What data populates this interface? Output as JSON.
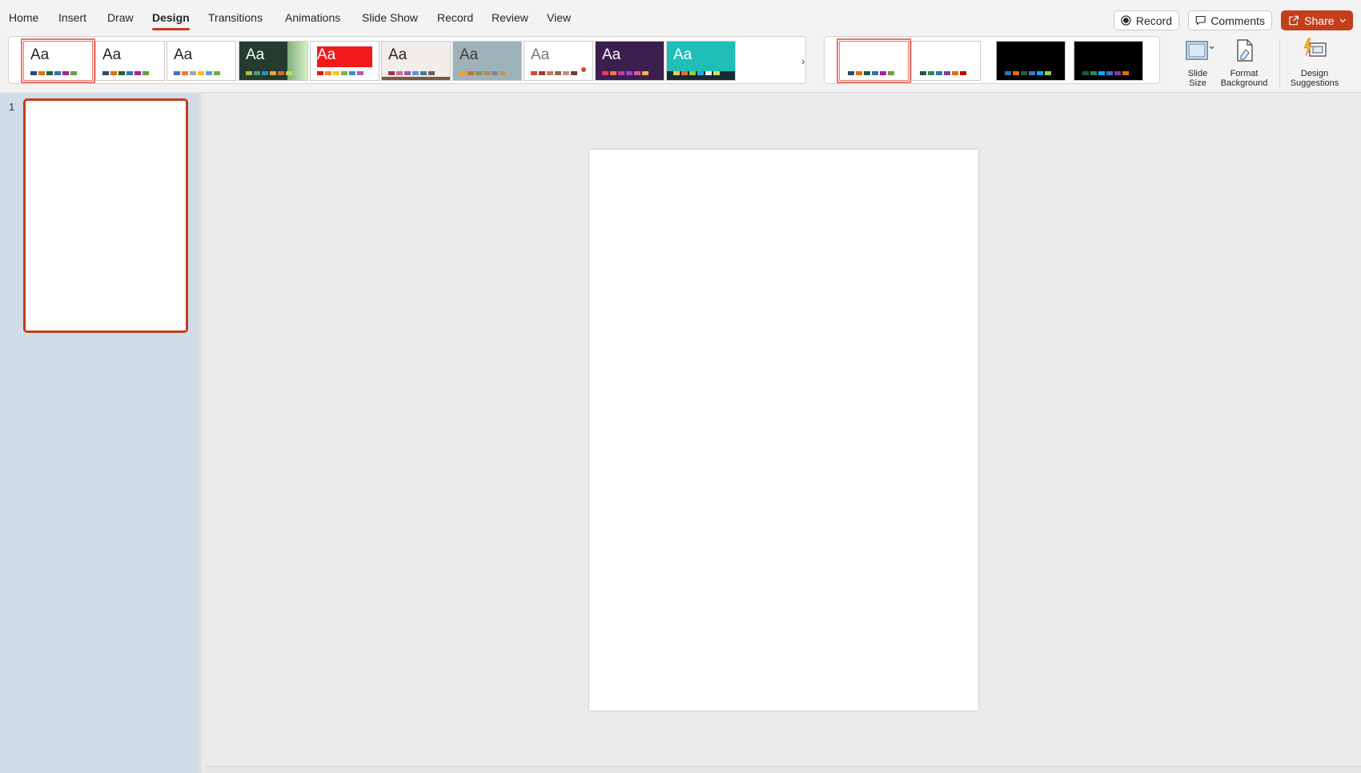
{
  "tabs": [
    {
      "label": "Home"
    },
    {
      "label": "Insert"
    },
    {
      "label": "Draw"
    },
    {
      "label": "Design"
    },
    {
      "label": "Transitions"
    },
    {
      "label": "Animations"
    },
    {
      "label": "Slide Show"
    },
    {
      "label": "Record"
    },
    {
      "label": "Review"
    },
    {
      "label": "View"
    }
  ],
  "active_tab": "Design",
  "top_buttons": {
    "record": "Record",
    "comments": "Comments",
    "share": "Share"
  },
  "themes": [
    {
      "label": "Aa",
      "bg": "#ffffff",
      "text": "#262626",
      "selected": true,
      "swatches": [
        "#1f4e79",
        "#e46c0a",
        "#1d5e3b",
        "#2e75b6",
        "#b1208f",
        "#62a33d"
      ]
    },
    {
      "label": "Aa",
      "bg": "#ffffff",
      "text": "#262626",
      "selected": false,
      "swatches": [
        "#1f4e79",
        "#e46c0a",
        "#1d5e3b",
        "#2e75b6",
        "#b1208f",
        "#62a33d"
      ]
    },
    {
      "label": "Aa",
      "bg": "#ffffff",
      "text": "#262626",
      "selected": false,
      "swatches": [
        "#4472c4",
        "#ed7d31",
        "#a5a5a5",
        "#ffc000",
        "#5b9bd5",
        "#70ad47"
      ]
    },
    {
      "label": "Aa",
      "bg": "#243b2e",
      "text": "#ffffff",
      "selected": false,
      "swatches": [
        "#a5c249",
        "#4a9b82",
        "#2e8fb5",
        "#e6a43a",
        "#d6643a",
        "#c4d65c"
      ]
    },
    {
      "label": "Aa",
      "bg": "#ffffff",
      "text": "#ffffff",
      "selected": false,
      "swatches": [
        "#e81416",
        "#f68b1f",
        "#f5c518",
        "#79b544",
        "#3c8fd1",
        "#b05bb5"
      ]
    },
    {
      "label": "Aa",
      "bg": "#f1ede8",
      "text": "#262626",
      "selected": false,
      "swatches": [
        "#a4303f",
        "#d06b9b",
        "#9b59b6",
        "#5b9bd5",
        "#4a7aa5",
        "#7a5c4f"
      ]
    },
    {
      "label": "Aa",
      "bg": "#9fb2ba",
      "text": "#3b3b3b",
      "selected": false,
      "swatches": [
        "#f0a30a",
        "#d36d2b",
        "#8a8f56",
        "#ab8a5f",
        "#7e8b8f",
        "#c09a6b"
      ]
    },
    {
      "label": "Aa",
      "bg": "#ffffff",
      "text": "#777777",
      "selected": false,
      "swatches": [
        "#d04a2d",
        "#9b3b2a",
        "#c97a5a",
        "#8a6c5a",
        "#b89582",
        "#7a3f33"
      ]
    },
    {
      "label": "Aa",
      "bg": "#3a1f4f",
      "text": "#ffffff",
      "selected": false,
      "swatches": [
        "#e0386b",
        "#ef7a3d",
        "#c23aa8",
        "#9b46c9",
        "#d85b9b",
        "#f1b04a"
      ]
    },
    {
      "label": "Aa",
      "bg": "#1fbfb8",
      "text": "#ffffff",
      "selected": false,
      "swatches": [
        "#f7c744",
        "#e56a3b",
        "#9acd32",
        "#2fa7d9",
        "#f1f1f1",
        "#d2e06b"
      ]
    }
  ],
  "variants": [
    {
      "bg": "#ffffff",
      "selected": true,
      "swatches": [
        "#1f4e79",
        "#e46c0a",
        "#1d5e3b",
        "#2e75b6",
        "#b1208f",
        "#62a33d"
      ]
    },
    {
      "bg": "#ffffff",
      "selected": false,
      "swatches": [
        "#1d5e3b",
        "#2e8b57",
        "#2e75b6",
        "#7f3f98",
        "#e46c0a",
        "#c00000"
      ]
    },
    {
      "bg": "#000000",
      "selected": false,
      "swatches": [
        "#2e75b6",
        "#e46c0a",
        "#1d5e3b",
        "#4472c4",
        "#00b0f0",
        "#92d050"
      ]
    },
    {
      "bg": "#000000",
      "selected": false,
      "swatches": [
        "#1d5e3b",
        "#2e8b57",
        "#00b0f0",
        "#4472c4",
        "#7f3f98",
        "#e46c0a"
      ]
    }
  ],
  "ribbon_buttons": {
    "slide_size": "Slide Size",
    "format_background": "Format Background",
    "design_suggestions": "Design Suggestions"
  },
  "slides": [
    {
      "number": "1"
    }
  ],
  "colors": {
    "accent": "#c43e1c",
    "pane_bg": "#cfdde8"
  }
}
